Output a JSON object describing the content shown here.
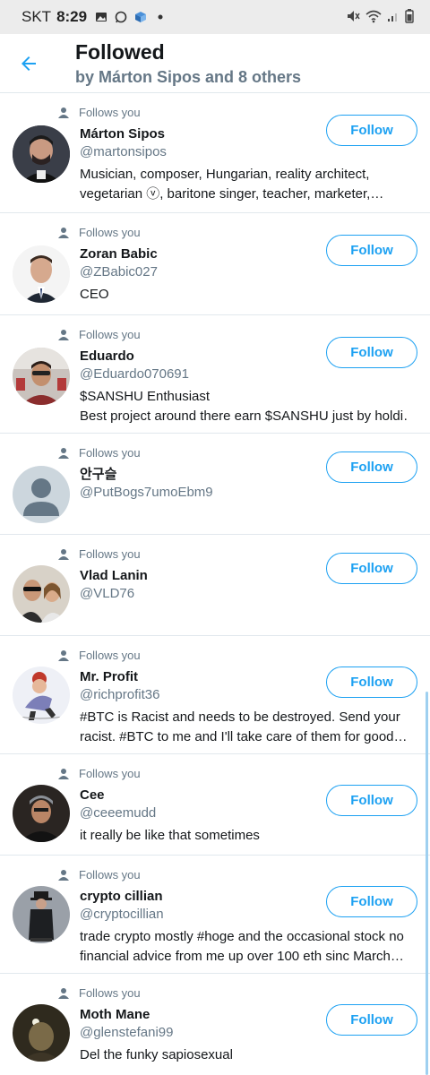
{
  "status": {
    "carrier": "SKT",
    "time": "8:29",
    "icons": [
      "gallery-icon",
      "whatsapp-icon",
      "vpn-icon",
      "dot-icon"
    ],
    "right_icons": [
      "mute-icon",
      "wifi-icon",
      "signal-icon",
      "battery-icon"
    ]
  },
  "header": {
    "title": "Followed",
    "subtitle": "by Márton Sipos and 8 others"
  },
  "follow_label": "Follow",
  "follows_you_label": "Follows you",
  "users": [
    {
      "name": "Márton Sipos",
      "handle": "@martonsipos",
      "bio": "Musician, composer, Hungarian, reality architect, vegetarian ⓥ, baritone singer, teacher, marketer, blogg…"
    },
    {
      "name": "Zoran Babic",
      "handle": "@ZBabic027",
      "bio": "CEO"
    },
    {
      "name": "Eduardo",
      "handle": "@Eduardo070691",
      "bio": "$SANSHU Enthusiast\nBest project around there earn $SANSHU just by holdi…"
    },
    {
      "name": "안구슬",
      "handle": "@PutBogs7umoEbm9",
      "bio": ""
    },
    {
      "name": "Vlad Lanin",
      "handle": "@VLD76",
      "bio": ""
    },
    {
      "name": "Mr. Profit",
      "handle": "@richprofit36",
      "bio": "#BTC is Racist and needs to be destroyed. Send your racist. #BTC to me and I'll take care of them for good. …"
    },
    {
      "name": "Cee",
      "handle": "@ceeemudd",
      "bio": "it really be like that sometimes"
    },
    {
      "name": "crypto cillian",
      "handle": "@cryptocillian",
      "bio": "trade crypto mostly #hoge and the occasional stock no financial advice from me up over 100 eth sinc March 🤑"
    },
    {
      "name": "Moth Mane",
      "handle": "@glenstefani99",
      "bio": "Del the funky sapiosexual"
    }
  ],
  "colors": {
    "accent": "#1da1f2",
    "muted": "#657786",
    "divider": "#e1e8ed"
  }
}
